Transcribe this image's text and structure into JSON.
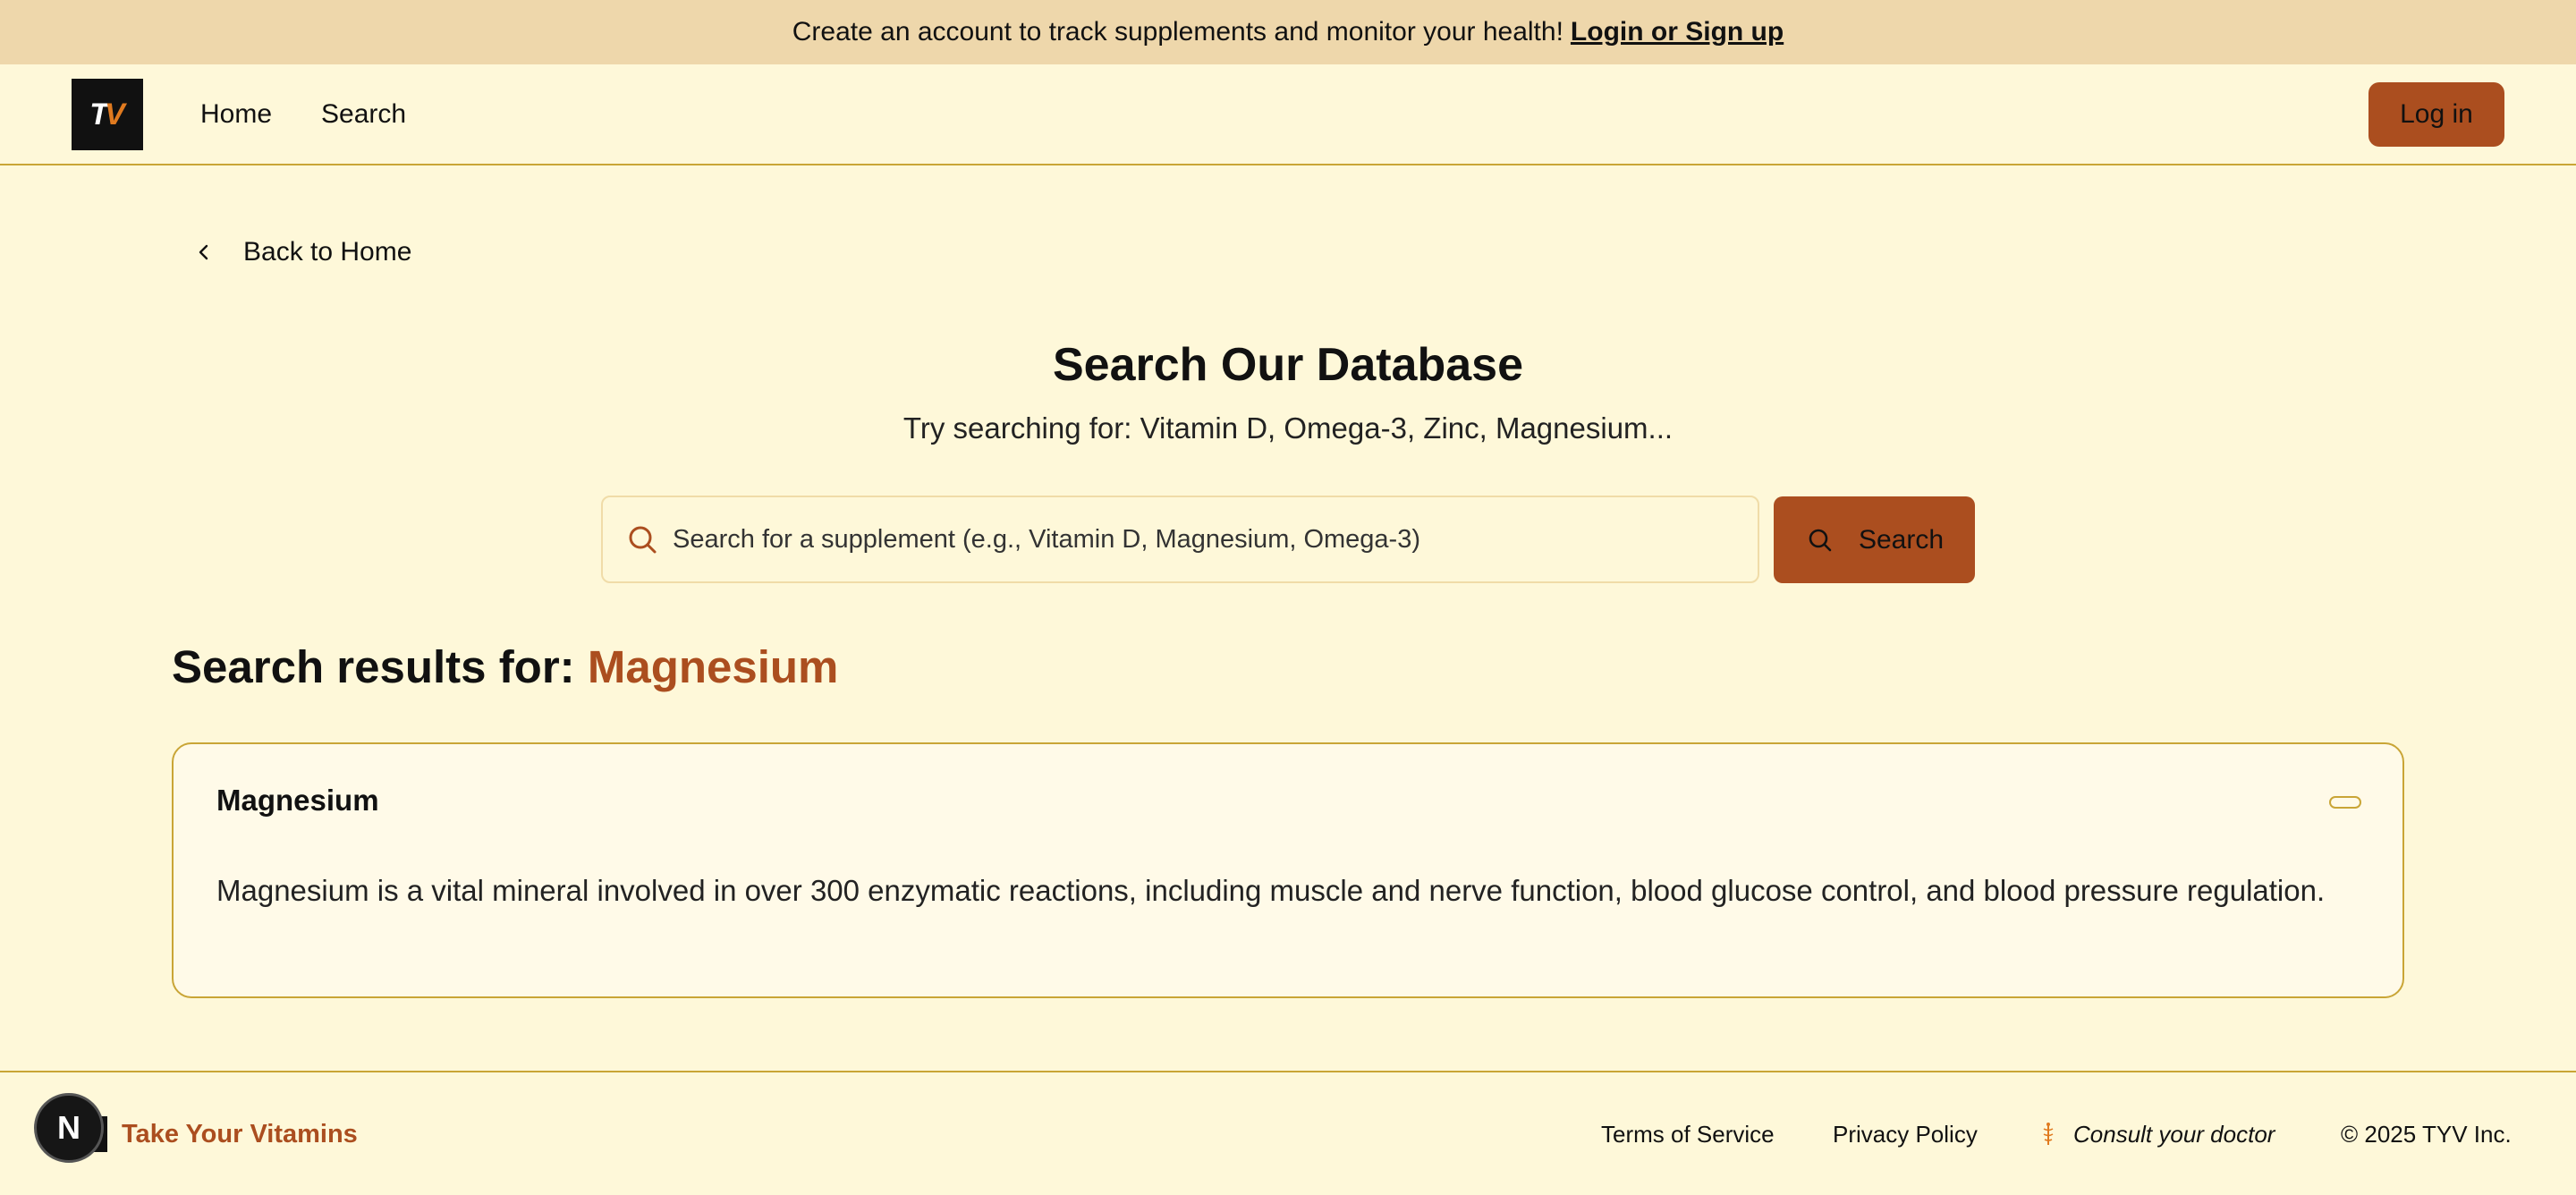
{
  "banner": {
    "text": "Create an account to track supplements and monitor your health!",
    "link": "Login or Sign up"
  },
  "navbar": {
    "logo_letters": "TV",
    "links": [
      "Home",
      "Search"
    ],
    "login_label": "Log in"
  },
  "back_label": "Back to Home",
  "page": {
    "title": "Search Our Database",
    "subtitle": "Try searching for: Vitamin D, Omega-3, Zinc, Magnesium..."
  },
  "search": {
    "placeholder": "Search for a supplement (e.g., Vitamin D, Magnesium, Omega-3)",
    "value": "",
    "button_label": "Search"
  },
  "results": {
    "prefix": "Search results for:",
    "term": "Magnesium",
    "items": [
      {
        "title": "Magnesium",
        "description": "Magnesium is a vital mineral involved in over 300 enzymatic reactions, including muscle and nerve function, blood glucose control, and blood pressure regulation."
      }
    ]
  },
  "footer": {
    "dev_badge": "N",
    "brand": "Take Your Vitamins",
    "terms": "Terms of Service",
    "privacy": "Privacy Policy",
    "consult": "Consult your doctor",
    "copyright": "© 2025 TYV Inc."
  },
  "colors": {
    "background": "#fef8d9",
    "banner": "#eed7ab",
    "accent": "#ab4e1f",
    "border": "#c9a536"
  }
}
